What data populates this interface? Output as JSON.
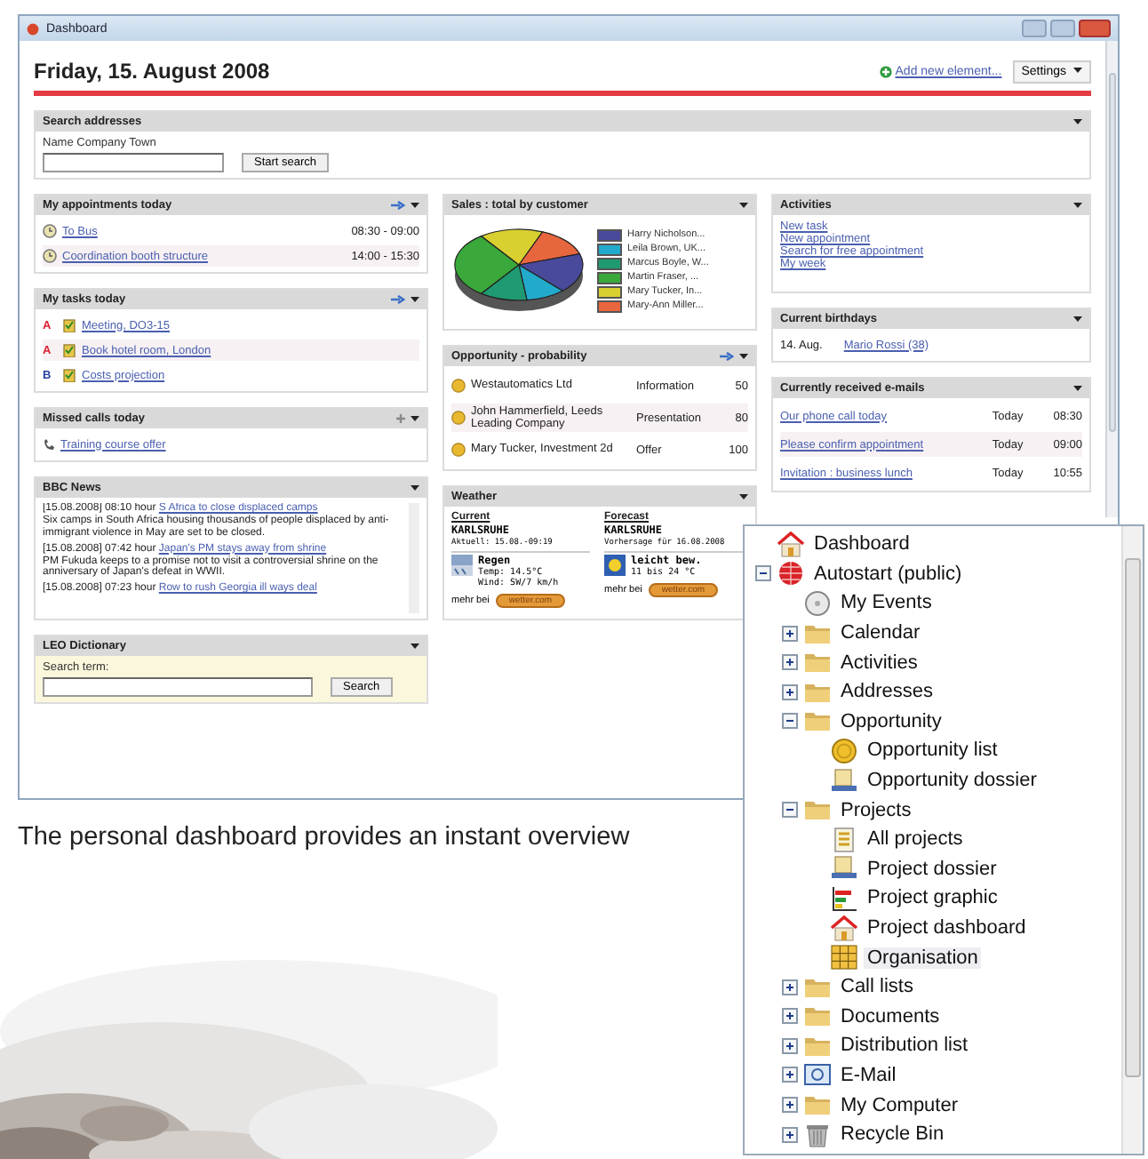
{
  "window": {
    "title": "Dashboard"
  },
  "header": {
    "date": "Friday, 15. August 2008",
    "add_link": "Add new element...",
    "settings": "Settings"
  },
  "search_addresses": {
    "title": "Search addresses",
    "field_label": "Name Company Town",
    "button": "Start search"
  },
  "appointments": {
    "title": "My appointments today",
    "rows": [
      {
        "subject": "To Bus",
        "time": "08:30 - 09:00"
      },
      {
        "subject": "Coordination booth structure",
        "time": "14:00 - 15:30"
      }
    ]
  },
  "tasks": {
    "title": "My tasks today",
    "rows": [
      {
        "priority": "A",
        "subject": "Meeting, DO3-15"
      },
      {
        "priority": "A",
        "subject": "Book hotel room, London"
      },
      {
        "priority": "B",
        "subject": "Costs projection"
      }
    ]
  },
  "missed_calls": {
    "title": "Missed calls today",
    "rows": [
      {
        "subject": "Training course offer"
      }
    ]
  },
  "news": {
    "title": "BBC News",
    "items": [
      {
        "stamp": "[15.08.2008] 08:10 hour",
        "headline": "S Africa to close displaced camps",
        "body": "Six camps in South Africa housing thousands of people displaced by anti-immigrant violence in May are set to be closed."
      },
      {
        "stamp": "[15.08.2008] 07:42 hour",
        "headline": "Japan's PM stays away from shrine",
        "body": "PM Fukuda keeps to a promise not to visit a controversial shrine on the anniversary of Japan's defeat in WWII."
      },
      {
        "stamp": "[15.08.2008] 07:23 hour",
        "headline": "Row to rush Georgia ill ways deal"
      }
    ]
  },
  "dictionary": {
    "title": "LEO Dictionary",
    "field_label": "Search term:",
    "button": "Search"
  },
  "sales": {
    "title": "Sales : total by customer",
    "legend": [
      {
        "name": "Harry Nicholson...",
        "color": "#4a4a9c"
      },
      {
        "name": "Leila Brown, UK...",
        "color": "#22aacc"
      },
      {
        "name": "Marcus Boyle, W...",
        "color": "#1f9a72"
      },
      {
        "name": "Martin Fraser, ...",
        "color": "#3aa83a"
      },
      {
        "name": "Mary Tucker, In...",
        "color": "#d8d030"
      },
      {
        "name": "Mary-Ann Miller...",
        "color": "#e8663e"
      }
    ]
  },
  "opportunity": {
    "title": "Opportunity - probability",
    "rows": [
      {
        "company": "Westautomatics Ltd",
        "phase": "Information",
        "percent": "50"
      },
      {
        "company": "John Hammerfield, Leeds Leading Company",
        "phase": "Presentation",
        "percent": "80"
      },
      {
        "company": "Mary Tucker, Investment 2d",
        "phase": "Offer",
        "percent": "100"
      }
    ]
  },
  "weather": {
    "title": "Weather",
    "panels": [
      {
        "kind": "rain",
        "label": "Current",
        "city": "KARLSRUHE",
        "stamp": "Aktuell: 15.08.-09:19",
        "condition": "Regen",
        "details": [
          "Temp: 14.5°C",
          "Wind: SW/7 km/h"
        ],
        "more": "mehr bei",
        "button": "wetter.com"
      },
      {
        "kind": "sun",
        "label": "Forecast",
        "city": "KARLSRUHE",
        "stamp": "Vorhersage für 16.08.2008",
        "condition": "leicht bew.",
        "details": [
          "11 bis 24 °C"
        ],
        "more": "mehr bei",
        "button": "wetter.com"
      }
    ]
  },
  "activities": {
    "title": "Activities",
    "links": [
      "New task",
      "New appointment",
      "Search for free appointment",
      "My week"
    ]
  },
  "birthdays": {
    "title": "Current birthdays",
    "rows": [
      {
        "date": "14. Aug.",
        "name": "Mario Rossi (38)"
      }
    ]
  },
  "emails": {
    "title": "Currently received e-mails",
    "rows": [
      {
        "subject": "Our phone call today",
        "day": "Today",
        "time": "08:30"
      },
      {
        "subject": "Please confirm appointment",
        "day": "Today",
        "time": "09:00"
      },
      {
        "subject": "Invitation : business lunch",
        "day": "Today",
        "time": "10:55"
      }
    ]
  },
  "caption": "The personal dashboard provides an instant overview",
  "tree": [
    {
      "label": "Dashboard",
      "kind": "home",
      "selected": false
    },
    {
      "label": "Autostart (public)",
      "kind": "globe",
      "selected": false,
      "expanded": true,
      "children": [
        {
          "label": "My Events",
          "kind": "disc",
          "selected": false
        },
        {
          "label": "Calendar",
          "kind": "folder",
          "selected": false,
          "expanded": false
        },
        {
          "label": "Activities",
          "kind": "folder",
          "selected": false,
          "expanded": false
        },
        {
          "label": "Addresses",
          "kind": "folder",
          "selected": false,
          "expanded": false
        },
        {
          "label": "Opportunity",
          "kind": "folder",
          "selected": false,
          "expanded": true,
          "children": [
            {
              "label": "Opportunity list",
              "kind": "coin",
              "selected": false
            },
            {
              "label": "Opportunity dossier",
              "kind": "dossier",
              "selected": false
            }
          ]
        },
        {
          "label": "Projects",
          "kind": "folder",
          "selected": false,
          "expanded": true,
          "children": [
            {
              "label": "All projects",
              "kind": "list",
              "selected": false
            },
            {
              "label": "Project dossier",
              "kind": "dossier",
              "selected": false
            },
            {
              "label": "Project graphic",
              "kind": "graphic",
              "selected": false
            },
            {
              "label": "Project dashboard",
              "kind": "home",
              "selected": false
            },
            {
              "label": "Organisation",
              "kind": "grid",
              "selected": true
            }
          ]
        },
        {
          "label": "Call lists",
          "kind": "folder",
          "selected": false,
          "expanded": false
        },
        {
          "label": "Documents",
          "kind": "folder",
          "selected": false,
          "expanded": false
        },
        {
          "label": "Distribution list",
          "kind": "folder",
          "selected": false,
          "expanded": false
        },
        {
          "label": "E-Mail",
          "kind": "mail",
          "selected": false,
          "expanded": false
        },
        {
          "label": "My Computer",
          "kind": "folder",
          "selected": false,
          "expanded": false
        },
        {
          "label": "Recycle Bin",
          "kind": "trash",
          "selected": false,
          "expanded": false
        }
      ]
    }
  ]
}
